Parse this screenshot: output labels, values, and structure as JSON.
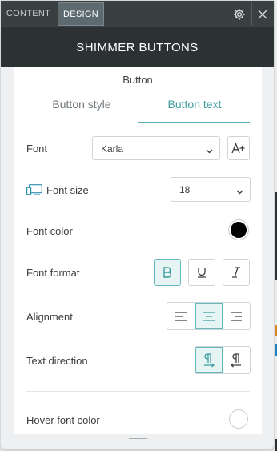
{
  "window": {
    "tabs": [
      {
        "label": "CONTENT",
        "active": false
      },
      {
        "label": "DESIGN",
        "active": true
      }
    ],
    "title": "SHIMMER BUTTONS",
    "icons": [
      "gear-icon",
      "close-icon"
    ]
  },
  "panel": {
    "heading": "Button",
    "sub_tabs": [
      {
        "label": "Button style",
        "active": false
      },
      {
        "label": "Button text",
        "active": true
      }
    ]
  },
  "settings": {
    "font": {
      "label": "Font",
      "value": "Karla"
    },
    "font_size": {
      "label": "Font size",
      "value": "18"
    },
    "font_color": {
      "label": "Font color",
      "color": "#000000"
    },
    "font_format": {
      "label": "Font format",
      "bold": true,
      "underline": false,
      "italic": false
    },
    "alignment": {
      "label": "Alignment",
      "options": [
        "left",
        "center",
        "right"
      ],
      "selected": "center"
    },
    "text_direction": {
      "label": "Text direction",
      "options": [
        "ltr",
        "rtl"
      ],
      "selected": "ltr"
    },
    "hover_font_color": {
      "label": "Hover font color",
      "color": "#ffffff"
    }
  },
  "colors": {
    "accent": "#3c9da0",
    "header_bg": "#2c3133",
    "topbar_bg": "#3a3f41"
  }
}
